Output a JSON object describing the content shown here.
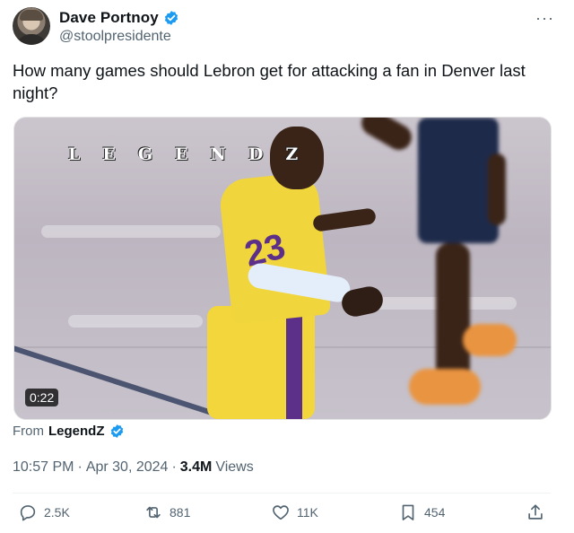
{
  "author": {
    "name": "Dave Portnoy",
    "handle": "@stoolpresidente",
    "verified_color": "#1d9bf0"
  },
  "more_menu": "···",
  "tweet": {
    "text": "How many games should Lebron get for attacking a fan in Denver last night?"
  },
  "media": {
    "watermark": "LEGENDZ",
    "duration": "0:22"
  },
  "source": {
    "from_label": "From",
    "name": "LegendZ"
  },
  "meta": {
    "time": "10:57 PM",
    "sep1": "·",
    "date": "Apr 30, 2024",
    "sep2": "·",
    "views_count": "3.4M",
    "views_label": "Views"
  },
  "actions": {
    "replies": "2.5K",
    "reposts": "881",
    "likes": "11K",
    "bookmarks": "454"
  },
  "icons": {
    "reply": "reply-icon",
    "repost": "repost-icon",
    "like": "heart-icon",
    "bookmark": "bookmark-icon",
    "share": "share-icon",
    "verified": "verified-badge-icon"
  },
  "colors": {
    "text": "#0f1419",
    "secondary": "#536471",
    "accent": "#1d9bf0"
  }
}
